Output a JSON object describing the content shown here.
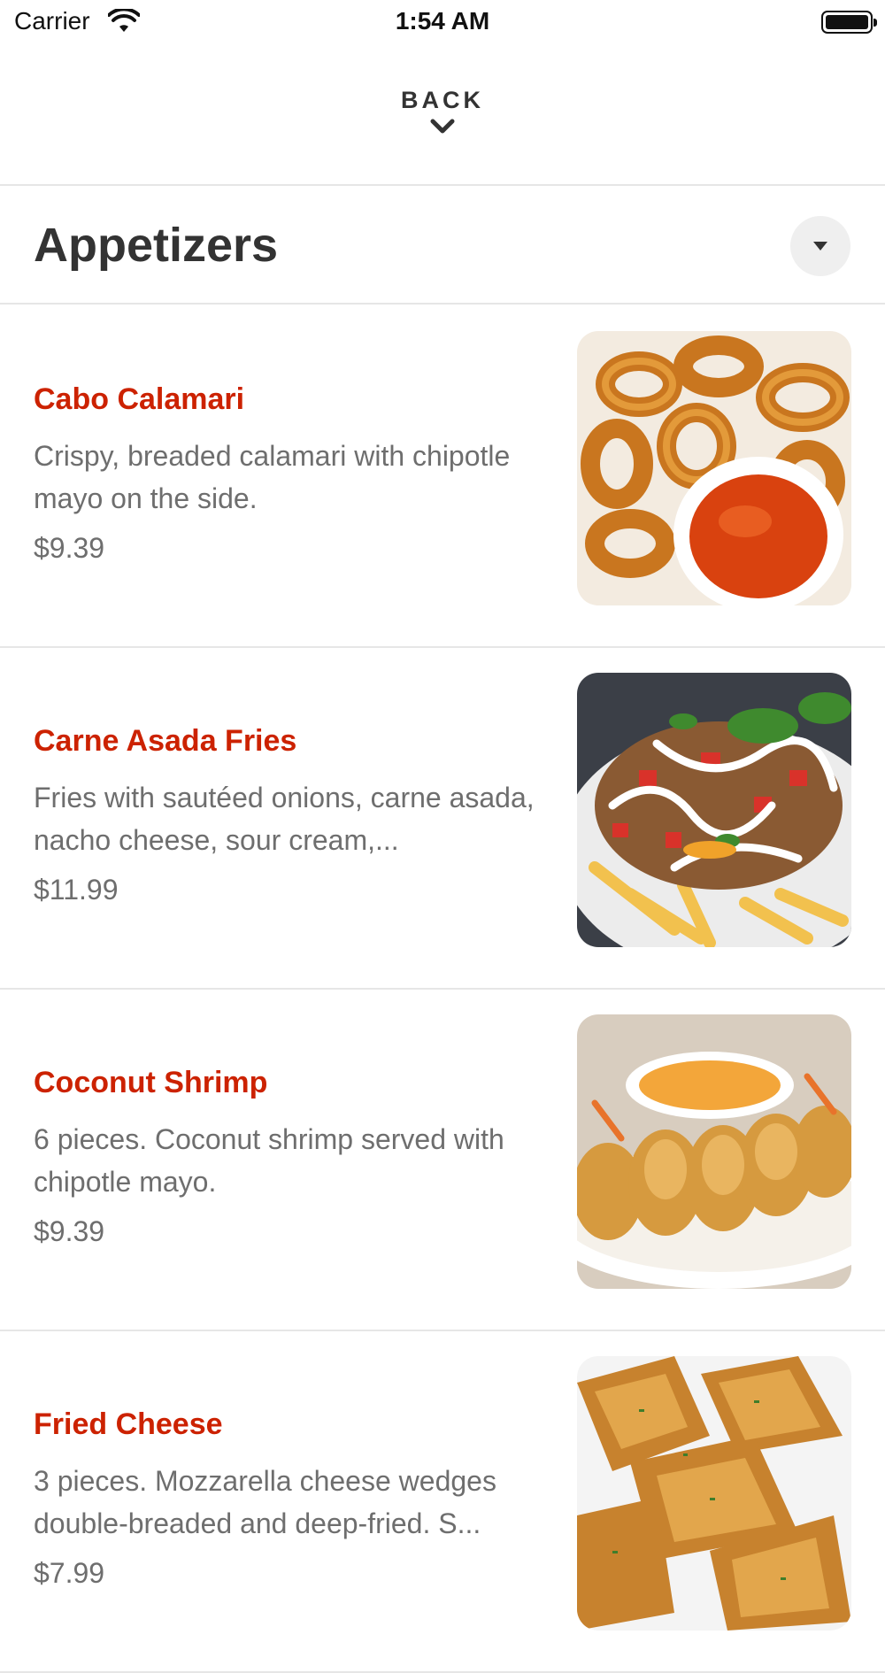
{
  "status_bar": {
    "carrier": "Carrier",
    "time": "1:54 AM"
  },
  "header": {
    "back_label": "BACK",
    "back_icon": "chevron-down-icon"
  },
  "section": {
    "title": "Appetizers",
    "toggle_icon": "caret-down-icon"
  },
  "items": [
    {
      "name": "Cabo Calamari",
      "description": "Crispy, breaded calamari with chipotle mayo on the side.",
      "price": "$9.39",
      "photo": "calamari-photo"
    },
    {
      "name": "Carne Asada Fries",
      "description": "Fries with sautéed onions, carne asada, nacho cheese, sour cream,...",
      "price": "$11.99",
      "photo": "carne-asada-fries-photo"
    },
    {
      "name": "Coconut Shrimp",
      "description": "6 pieces. Coconut shrimp served with chipotle mayo.",
      "price": "$9.39",
      "photo": "coconut-shrimp-photo"
    },
    {
      "name": "Fried Cheese",
      "description": "3 pieces. Mozzarella cheese wedges double-breaded and deep-fried. S...",
      "price": "$7.99",
      "photo": "fried-cheese-photo"
    }
  ],
  "colors": {
    "item_name": "#cc2200",
    "secondary_text": "#6e6e6e",
    "divider": "#e6e6e6",
    "toggle_bg": "#efefef"
  }
}
